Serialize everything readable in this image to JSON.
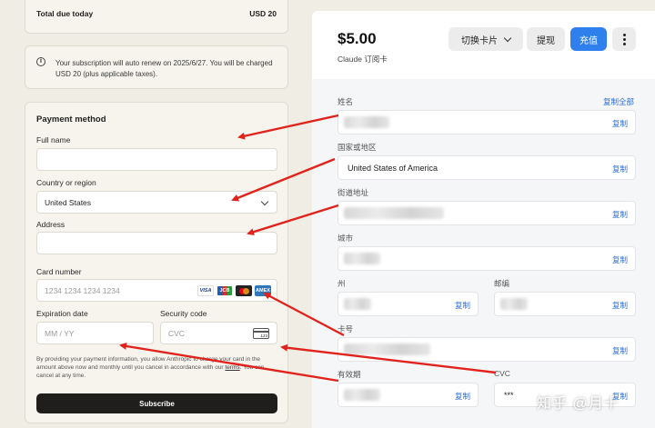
{
  "checkout": {
    "total_label": "Total due today",
    "total_value": "USD 20",
    "renew_note": "Your subscription will auto renew on 2025/6/27. You will be charged USD 20 (plus applicable taxes).",
    "payment_title": "Payment method",
    "full_name_label": "Full name",
    "full_name_value": "",
    "country_label": "Country or region",
    "country_value": "United States",
    "address_label": "Address",
    "address_value": "",
    "card_number_label": "Card number",
    "card_number_placeholder": "1234 1234 1234 1234",
    "card_brands": [
      "VISA",
      "JCB",
      "mastercard",
      "AMEX"
    ],
    "expiration_label": "Expiration date",
    "expiration_placeholder": "MM / YY",
    "security_label": "Security code",
    "security_placeholder": "CVC",
    "cvc_icon_text": "123",
    "legal_text_before": "By providing your payment information, you allow Anthropic to charge your card in the amount above now and monthly until you cancel in accordance with our",
    "legal_link": "terms",
    "legal_text_after": ". You can cancel at any time.",
    "subscribe_label": "Subscribe"
  },
  "virtual_card": {
    "amount": "$5.00",
    "card_name": "Claude 订阅卡",
    "switch_card_label": "切换卡片",
    "withdraw_label": "提现",
    "topup_label": "充值",
    "copy_all_label": "复制全部",
    "copy_label": "复制",
    "fields": {
      "name_label": "姓名",
      "country_label": "国家或地区",
      "country_value": "United States of America",
      "street_label": "街道地址",
      "city_label": "城市",
      "state_label": "州",
      "zip_label": "邮编",
      "card_number_label": "卡号",
      "expiry_label": "有效期",
      "cvc_label": "CVC",
      "cvc_value": "***"
    }
  },
  "watermark": "知乎 @月十",
  "colors": {
    "accent_blue": "#2f80ed",
    "arrow_red": "#e0231c",
    "subscribe_bg": "#1f1e1d"
  }
}
